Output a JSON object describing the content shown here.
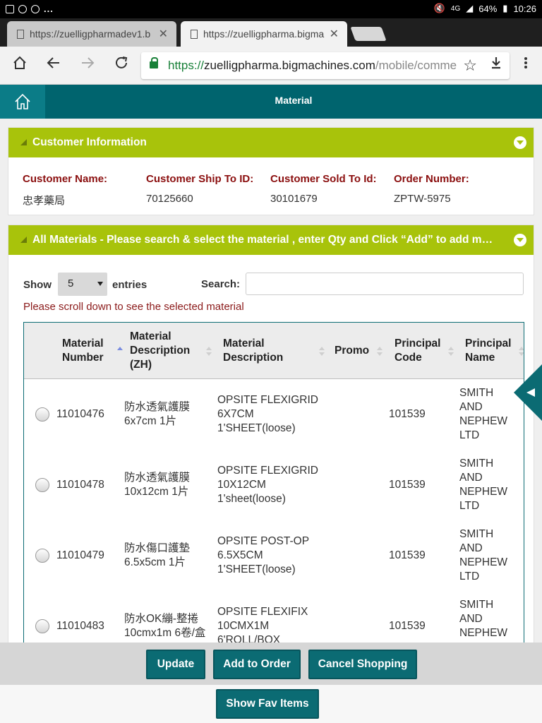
{
  "status_bar": {
    "battery": "64%",
    "time": "10:26",
    "network": "4G",
    "overflow": "..."
  },
  "browser": {
    "tabs": [
      {
        "title": "https://zuelligpharmadev1.b",
        "close": "✕"
      },
      {
        "title": "https://zuelligpharma.bigma",
        "close": "✕"
      }
    ],
    "url": {
      "scheme": "https://",
      "host": "zuelligpharma.bigmachines.com",
      "path": "/mobile/commer"
    }
  },
  "app_header": {
    "title": "Material"
  },
  "customer_panel": {
    "title": "Customer Information",
    "fields": [
      {
        "label": "Customer Name:",
        "value": "忠孝藥局"
      },
      {
        "label": "Customer Ship To ID:",
        "value": "70125660"
      },
      {
        "label": "Customer Sold To Id:",
        "value": "30101679"
      },
      {
        "label": "Order Number:",
        "value": "ZPTW-5975"
      }
    ]
  },
  "materials_panel": {
    "title": "All Materials - Please search & select the material , enter Qty and Click “Add” to add material",
    "show_label": "Show",
    "entries_value": "5",
    "entries_label": "entries",
    "search_label": "Search:",
    "search_value": "",
    "note": "Please scroll down to see the selected material",
    "columns": [
      {
        "label": "Material Number"
      },
      {
        "label": "Material Description (ZH)"
      },
      {
        "label": "Material Description"
      },
      {
        "label": "Promo"
      },
      {
        "label": "Principal Code"
      },
      {
        "label": "Principal Name"
      }
    ],
    "rows": [
      {
        "number": "11010476",
        "desc_zh": "防水透氣護膜 6x7cm 1片",
        "desc": "OPSITE FLEXIGRID 6X7CM 1'SHEET(loose)",
        "promo": "",
        "principal_code": "101539",
        "principal_name": "SMITH AND NEPHEW LTD"
      },
      {
        "number": "11010478",
        "desc_zh": "防水透氣護膜 10x12cm 1片",
        "desc": "OPSITE FLEXIGRID 10X12CM 1'sheet(loose)",
        "promo": "",
        "principal_code": "101539",
        "principal_name": "SMITH AND NEPHEW LTD"
      },
      {
        "number": "11010479",
        "desc_zh": "防水傷口護墊 6.5x5cm 1片",
        "desc": "OPSITE POST-OP 6.5X5CM 1'SHEET(loose)",
        "promo": "",
        "principal_code": "101539",
        "principal_name": "SMITH AND NEPHEW LTD"
      },
      {
        "number": "11010483",
        "desc_zh": "防水OK繃-整捲 10cmx1m 6卷/盒",
        "desc": "OPSITE FLEXIFIX 10CMX1M 6'ROLL/BOX",
        "promo": "",
        "principal_code": "101539",
        "principal_name": "SMITH AND NEPHEW LTD"
      }
    ]
  },
  "footer": {
    "update": "Update",
    "add_to_order": "Add to Order",
    "cancel_shopping": "Cancel Shopping",
    "show_fav": "Show Fav Items"
  }
}
